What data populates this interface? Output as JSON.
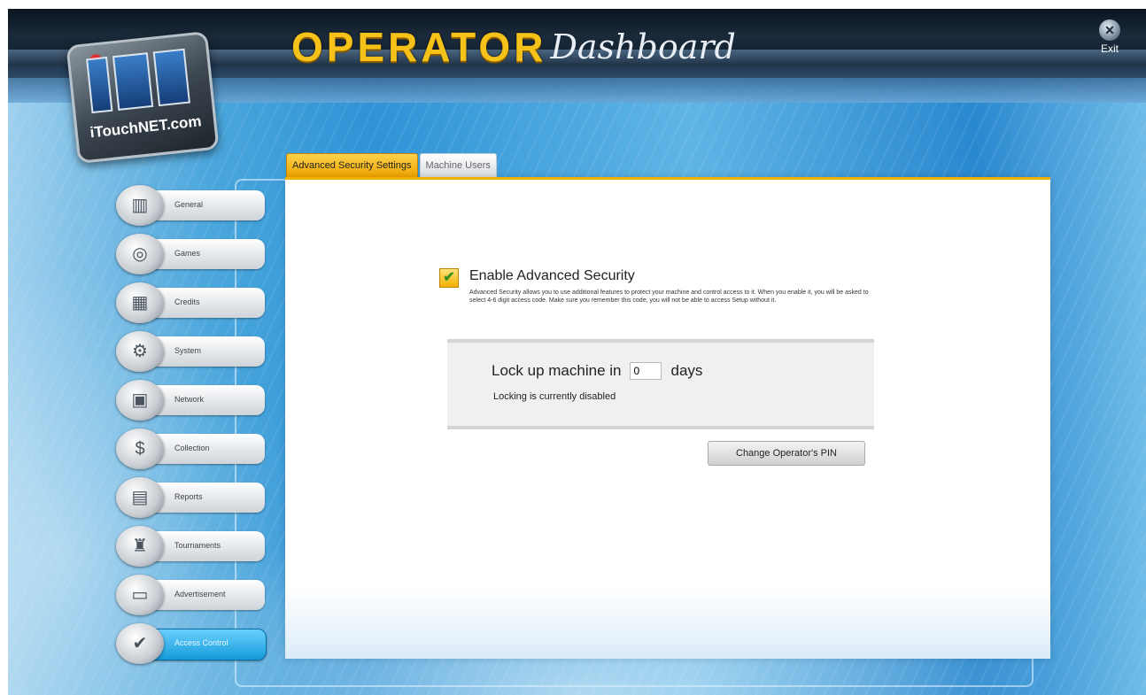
{
  "app": {
    "logo_text": "iTouchNET.com",
    "title_main": "OPERATOR",
    "title_script": "Dashboard",
    "exit_label": "Exit"
  },
  "tabs": [
    {
      "label": "Advanced Security Settings",
      "active": true
    },
    {
      "label": "Machine Users",
      "active": false
    }
  ],
  "security": {
    "enabled": true,
    "title": "Enable Advanced Security",
    "description": "Advanced Security allows you to use additional features to protect your machine and control access to it. When you enable it, you will be asked to select 4-6 digit access code. Make sure you remember this code, you will not be able to access Setup without it."
  },
  "lock": {
    "prefix": "Lock up machine in",
    "days_value": "0",
    "suffix": "days",
    "status": "Locking is currently disabled"
  },
  "pin_button": "Change Operator's PIN",
  "sidebar": {
    "items": [
      {
        "label": "General",
        "icon": "cabinet-icon",
        "active": false
      },
      {
        "label": "Games",
        "icon": "games-icon",
        "active": false
      },
      {
        "label": "Credits",
        "icon": "credits-icon",
        "active": false
      },
      {
        "label": "System",
        "icon": "system-icon",
        "active": false
      },
      {
        "label": "Network",
        "icon": "network-icon",
        "active": false
      },
      {
        "label": "Collection",
        "icon": "dollar-icon",
        "active": false
      },
      {
        "label": "Reports",
        "icon": "reports-icon",
        "active": false
      },
      {
        "label": "Tournaments",
        "icon": "trophy-icon",
        "active": false
      },
      {
        "label": "Advertisement",
        "icon": "advertisement-icon",
        "active": false
      },
      {
        "label": "Access Control",
        "icon": "access-control-icon",
        "active": true
      }
    ]
  },
  "colors": {
    "accent_orange": "#f0a400",
    "active_blue": "#159ad8",
    "title_gold": "#f5c21a"
  }
}
